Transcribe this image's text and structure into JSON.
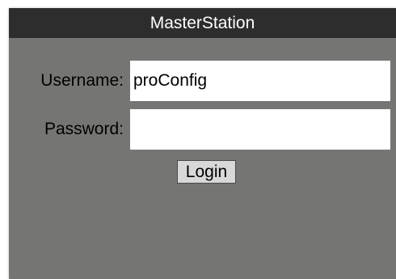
{
  "window": {
    "title": "MasterStation"
  },
  "form": {
    "username_label": "Username:",
    "username_value": "proConfig",
    "password_label": "Password:",
    "password_value": "",
    "login_label": "Login"
  },
  "colors": {
    "titlebar": "#2d2d2d",
    "panel": "#757673",
    "button": "#d8d8d8"
  }
}
